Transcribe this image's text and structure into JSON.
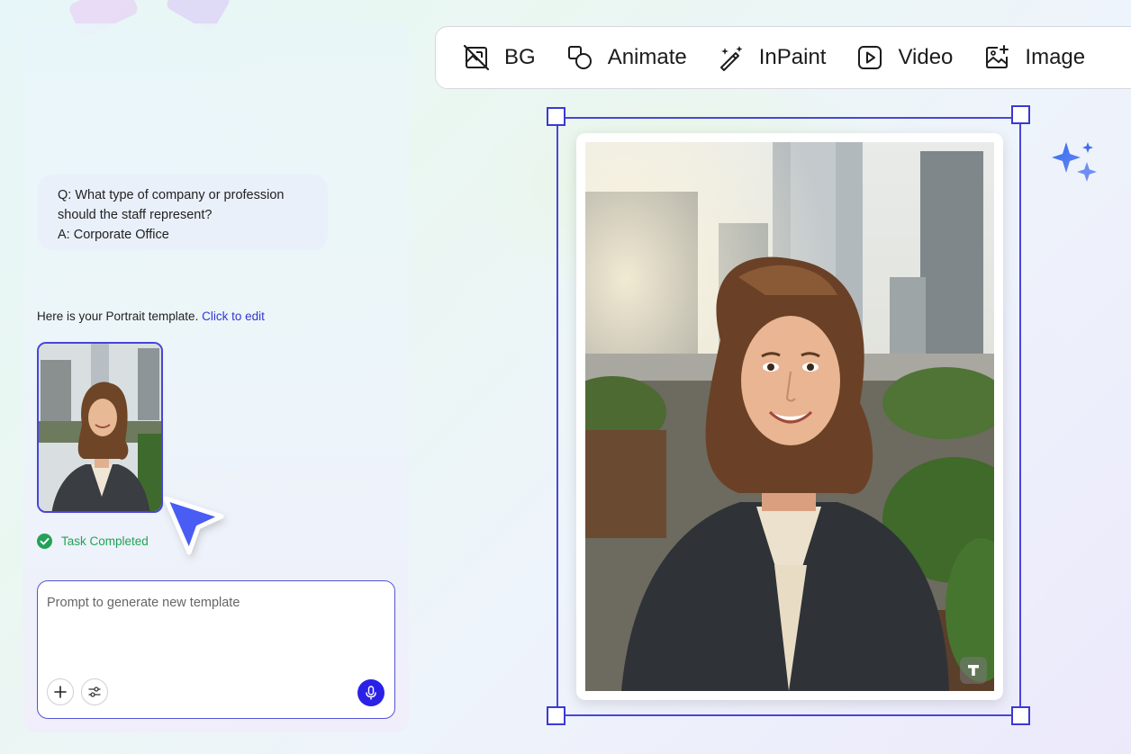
{
  "chat": {
    "question": "Q: What type of company or profession",
    "question_cont": "should the staff represent?",
    "answer": "A: Corporate Office",
    "template_text": "Here is your Portrait template.",
    "edit_link": "Click to edit",
    "status": "Task Completed"
  },
  "prompt": {
    "placeholder": "Prompt to generate new template"
  },
  "toolbar": {
    "items": [
      {
        "label": "BG",
        "icon": "bg-remove-icon"
      },
      {
        "label": "Animate",
        "icon": "animate-icon"
      },
      {
        "label": "InPaint",
        "icon": "magic-wand-icon"
      },
      {
        "label": "Video",
        "icon": "video-play-icon"
      },
      {
        "label": "Image",
        "icon": "image-add-icon"
      }
    ]
  },
  "colors": {
    "accent": "#4a46d6",
    "success": "#23a256",
    "link": "#3335d6",
    "mic": "#2b21e6"
  }
}
